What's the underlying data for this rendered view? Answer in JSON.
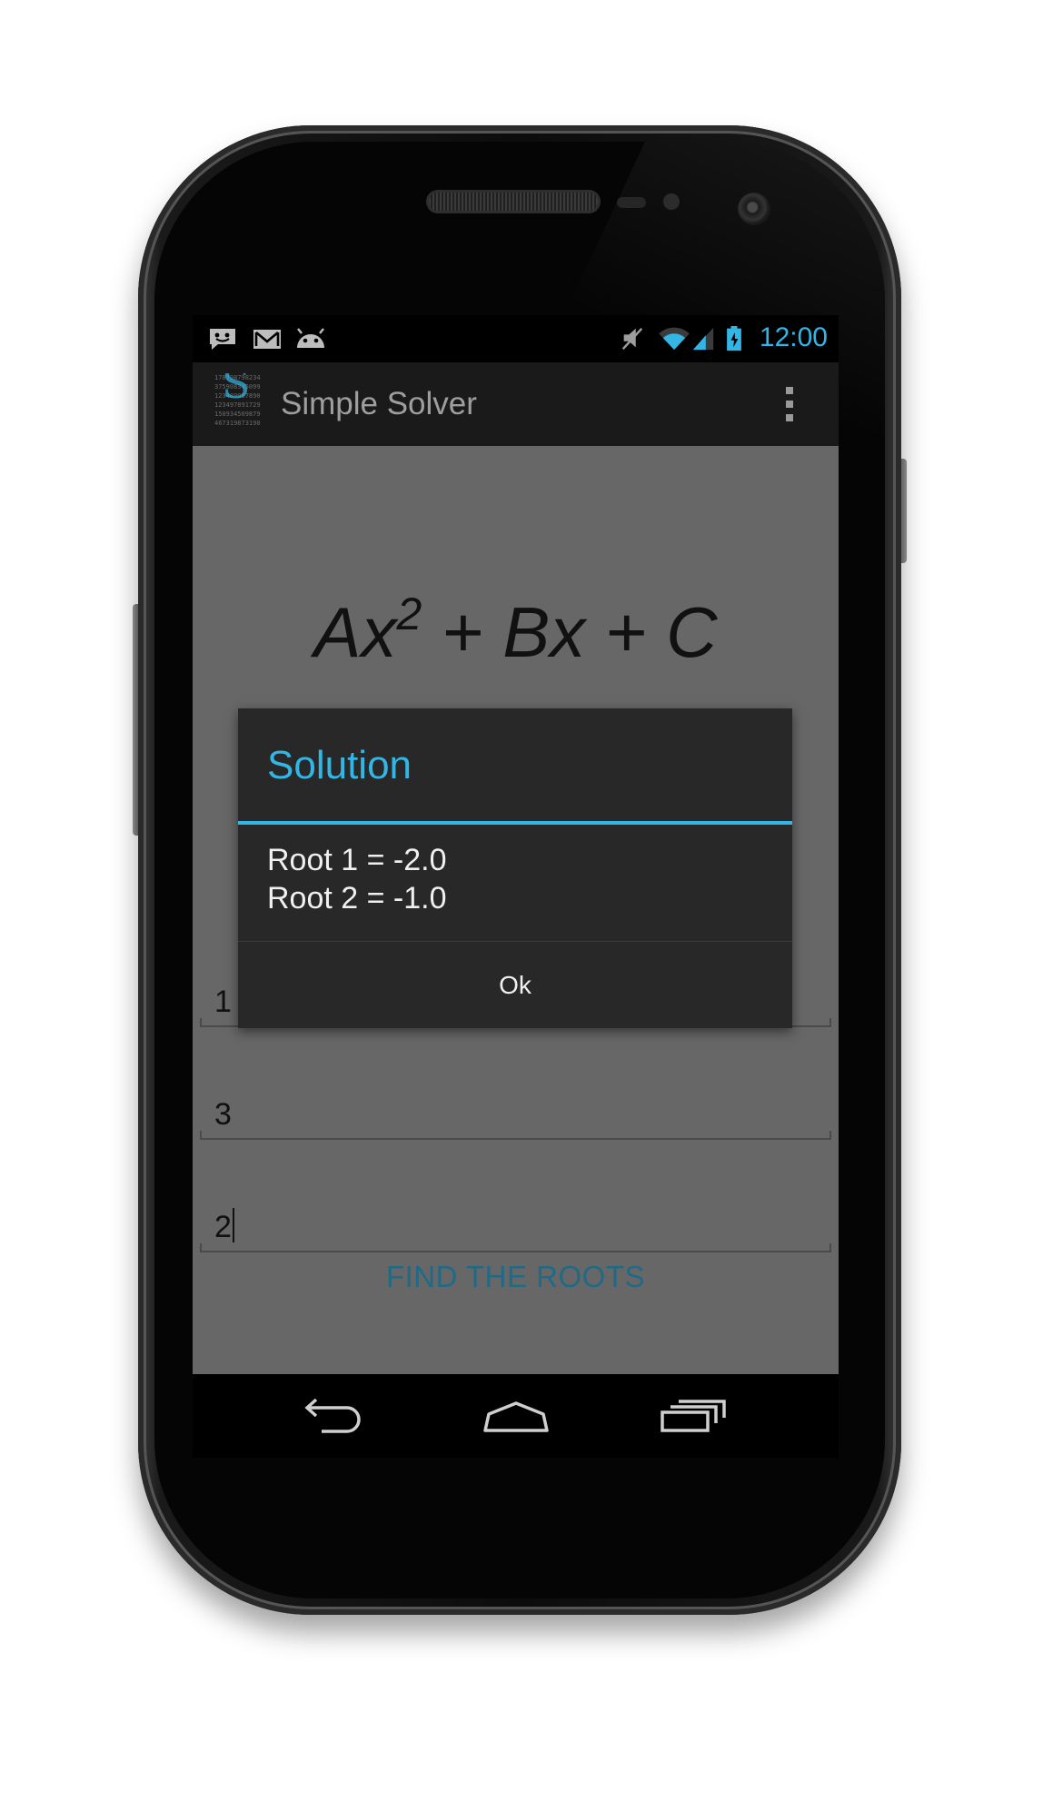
{
  "status_bar": {
    "time": "12:00",
    "notification_icons": [
      "talk-icon",
      "gmail-icon",
      "android-icon"
    ],
    "system_icons": [
      "mute-icon",
      "wifi-icon",
      "signal-icon",
      "battery-charging-icon"
    ]
  },
  "action_bar": {
    "app_title": "Simple Solver",
    "logo_digits": [
      "178798798234",
      "375908345099",
      "123409097890",
      "123497891729",
      "150934509879",
      "467319873190"
    ],
    "logo_letter": "S"
  },
  "main": {
    "equation": {
      "part1": "Ax",
      "exponent": "2",
      "part2": " + Bx + C"
    },
    "fields": [
      {
        "value": "1"
      },
      {
        "value": "3"
      },
      {
        "value": "2"
      }
    ],
    "find_button_label": "FIND THE ROOTS"
  },
  "dialog": {
    "title": "Solution",
    "line1": "Root 1 = -2.0",
    "line2": "Root 2 = -1.0",
    "ok_label": "Ok"
  },
  "nav_bar": {
    "icons": [
      "back-icon",
      "home-icon",
      "recent-apps-icon"
    ]
  },
  "colors": {
    "accent": "#33b5e5",
    "screen_background": "#676767",
    "dialog_background": "#282828",
    "button_text": "#1f6a86"
  }
}
